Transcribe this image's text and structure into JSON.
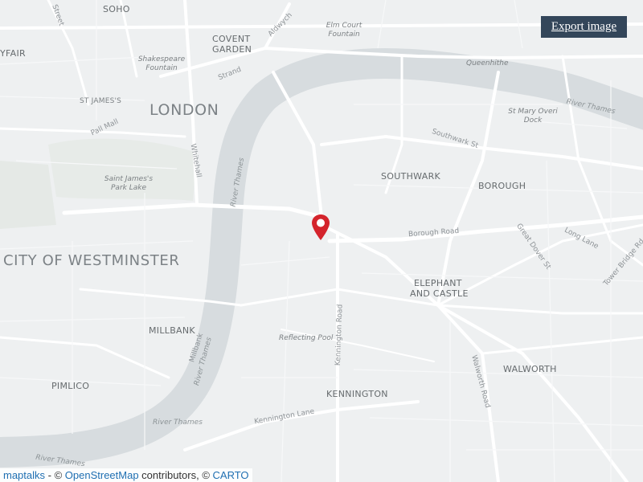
{
  "map": {
    "export_button": "Export image",
    "labels": {
      "soho": "SOHO",
      "mayfair": "YFAIR",
      "covent_garden_1": "COVENT",
      "covent_garden_2": "GARDEN",
      "london": "LONDON",
      "st_james": "ST JAMES'S",
      "westminster": "CITY OF WESTMINSTER",
      "southwark": "SOUTHWARK",
      "borough": "BOROUGH",
      "elephant_1": "ELEPHANT",
      "elephant_2": "AND CASTLE",
      "millbank": "MILLBANK",
      "pimlico": "PIMLICO",
      "kennington": "KENNINGTON",
      "walworth": "WALWORTH",
      "elm_court_1": "Elm Court",
      "elm_court_2": "Fountain",
      "shakespeare_1": "Shakespeare",
      "shakespeare_2": "Fountain",
      "st_james_park_1": "Saint James's",
      "st_james_park_2": "Park Lake",
      "st_mary_1": "St Mary Overi",
      "st_mary_2": "Dock",
      "reflecting_pool": "Reflecting Pool",
      "queenhithe": "Queenhithe",
      "river_thames_ne": "River Thames",
      "river_thames_w": "River Thames",
      "river_thames_sw1": "River Thames",
      "river_thames_sw2": "River Thames",
      "river_thames_s": "River Thames",
      "strand": "Strand",
      "aldwych": "Aldwych",
      "pall_mall": "Pall Mall",
      "whitehall": "Whitehall",
      "southwark_st": "Southwark St",
      "borough_road": "Borough Road",
      "great_dover_st": "Great Dover St",
      "long_lane": "Long Lane",
      "tower_bridge_rd": "Tower Bridge Rd",
      "kennington_road": "Kennington Road",
      "walworth_road": "Walworth Road",
      "kennington_lane": "Kennington Lane",
      "millbank_st": "Millbank",
      "street_nw": "Street"
    },
    "attribution": {
      "maptalks": "maptalks",
      "sep1": " - © ",
      "osm": "OpenStreetMap",
      "sep2": " contributors, © ",
      "carto": "CARTO"
    },
    "colors": {
      "land": "#eef0f1",
      "water": "#d7dcdf",
      "road": "#ffffff",
      "marker": "#d4242c"
    }
  }
}
